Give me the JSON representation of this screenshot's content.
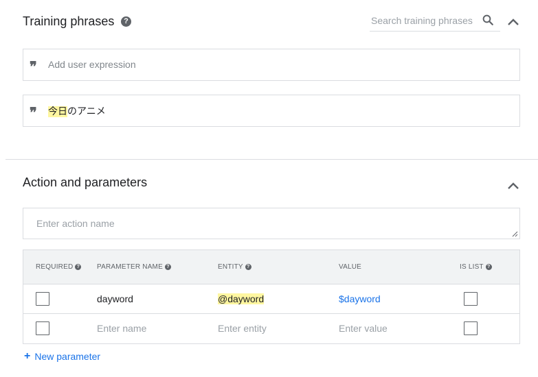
{
  "training": {
    "title": "Training phrases",
    "help_icon": "?",
    "search_placeholder": "Search training phrases",
    "add_placeholder": "Add user expression",
    "phrases": [
      {
        "highlighted": "今日",
        "rest": "のアニメ"
      }
    ]
  },
  "action": {
    "title": "Action and parameters",
    "action_placeholder": "Enter action name"
  },
  "params": {
    "headers": {
      "required": "REQUIRED",
      "name": "PARAMETER NAME",
      "entity": "ENTITY",
      "value": "VALUE",
      "is_list": "IS LIST"
    },
    "rows": [
      {
        "name": "dayword",
        "entity": "@dayword",
        "value": "$dayword"
      }
    ],
    "empty_row": {
      "name_placeholder": "Enter name",
      "entity_placeholder": "Enter entity",
      "value_placeholder": "Enter value"
    }
  },
  "new_parameter": {
    "plus": "+",
    "label": "New parameter"
  },
  "colors": {
    "accent": "#1a73e8",
    "highlight": "#fef6a0",
    "border": "#dadce0",
    "header_bg": "#f1f3f4"
  },
  "icons": [
    "help-icon",
    "search-icon",
    "chevron-up-icon",
    "quote-icon",
    "plus-icon",
    "resize-handle-icon"
  ]
}
